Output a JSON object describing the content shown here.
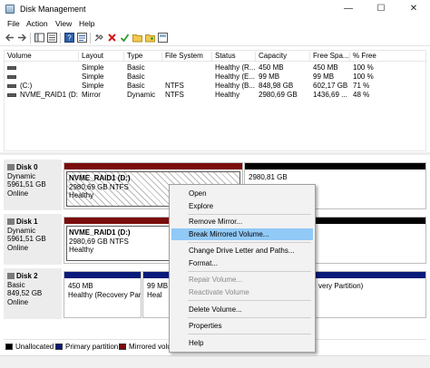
{
  "window": {
    "title": "Disk Management",
    "minimize": "—",
    "maximize": "☐",
    "close": "✕"
  },
  "menu": [
    "File",
    "Action",
    "View",
    "Help"
  ],
  "volume_list": {
    "columns": [
      "Volume",
      "Layout",
      "Type",
      "File System",
      "Status",
      "Capacity",
      "Free Spa...",
      "% Free"
    ],
    "rows": [
      [
        "",
        "Simple",
        "Basic",
        "",
        "Healthy (R...",
        "450 MB",
        "450 MB",
        "100 %"
      ],
      [
        "",
        "Simple",
        "Basic",
        "",
        "Healthy (E...",
        "99 MB",
        "99 MB",
        "100 %"
      ],
      [
        "(C:)",
        "Simple",
        "Basic",
        "NTFS",
        "Healthy (B...",
        "848,98 GB",
        "602,17 GB",
        "71 %"
      ],
      [
        "NVME_RAID1 (D:)",
        "Mirror",
        "Dynamic",
        "NTFS",
        "Healthy",
        "2980,69 GB",
        "1436,69 ...",
        "48 %"
      ]
    ]
  },
  "disks": [
    {
      "name": "Disk 0",
      "type": "Dynamic",
      "size": "5961,51 GB",
      "status": "Online",
      "partitions": [
        {
          "name": "NVME_RAID1 (D:)",
          "detail": "2980,69 GB NTFS",
          "status": "Healthy",
          "kind": "mirrored"
        },
        {
          "name": "",
          "detail": "2980,81 GB",
          "status": "",
          "kind": "unallocated"
        }
      ]
    },
    {
      "name": "Disk 1",
      "type": "Dynamic",
      "size": "5961,51 GB",
      "status": "Online",
      "partitions": [
        {
          "name": "NVME_RAID1 (D:)",
          "detail": "2980,69 GB NTFS",
          "status": "Healthy",
          "kind": "mirrored"
        },
        {
          "name": "",
          "detail": "",
          "status": "",
          "kind": "unallocated"
        }
      ]
    },
    {
      "name": "Disk 2",
      "type": "Basic",
      "size": "849,52 GB",
      "status": "Online",
      "partitions": [
        {
          "name": "",
          "detail": "450 MB",
          "status": "Healthy (Recovery Partiti",
          "kind": "primary"
        },
        {
          "name": "",
          "detail": "99 MB",
          "status": "Heal",
          "kind": "primary"
        },
        {
          "name": "",
          "detail": "",
          "status": "very Partition)",
          "kind": "primary"
        }
      ]
    }
  ],
  "legend": [
    {
      "label": "Unallocated",
      "color": "#000000"
    },
    {
      "label": "Primary partition",
      "color": "#0a1a7a"
    },
    {
      "label": "Mirrored volu",
      "color": "#7a0c0c"
    }
  ],
  "context_menu": {
    "items": [
      {
        "label": "Open",
        "enabled": true
      },
      {
        "label": "Explore",
        "enabled": true
      },
      {
        "label": "Remove Mirror...",
        "enabled": true
      },
      {
        "label": "Break Mirrored Volume...",
        "enabled": true,
        "highlighted": true
      },
      {
        "label": "Change Drive Letter and Paths...",
        "enabled": true
      },
      {
        "label": "Format...",
        "enabled": true
      },
      {
        "label": "Repair Volume...",
        "enabled": false
      },
      {
        "label": "Reactivate Volume",
        "enabled": false
      },
      {
        "label": "Delete Volume...",
        "enabled": true
      },
      {
        "label": "Properties",
        "enabled": true
      },
      {
        "label": "Help",
        "enabled": true
      }
    ]
  },
  "colors": {
    "mirrored": "#7a0c0c",
    "primary": "#0a1a7a",
    "unallocated": "#000000",
    "highlight": "#91c9f7"
  }
}
